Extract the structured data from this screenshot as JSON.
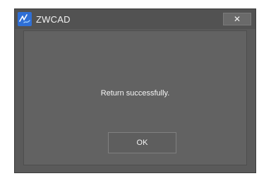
{
  "window": {
    "title": "ZWCAD",
    "app_icon": "zwcad-logo-icon",
    "close_label": "✕"
  },
  "dialog": {
    "message": "Return successfully.",
    "ok_label": "OK"
  },
  "colors": {
    "dialog_bg": "#5a5a5a",
    "client_bg": "#626262",
    "icon_blue": "#2f6fd6",
    "text": "#f5f5f5"
  }
}
